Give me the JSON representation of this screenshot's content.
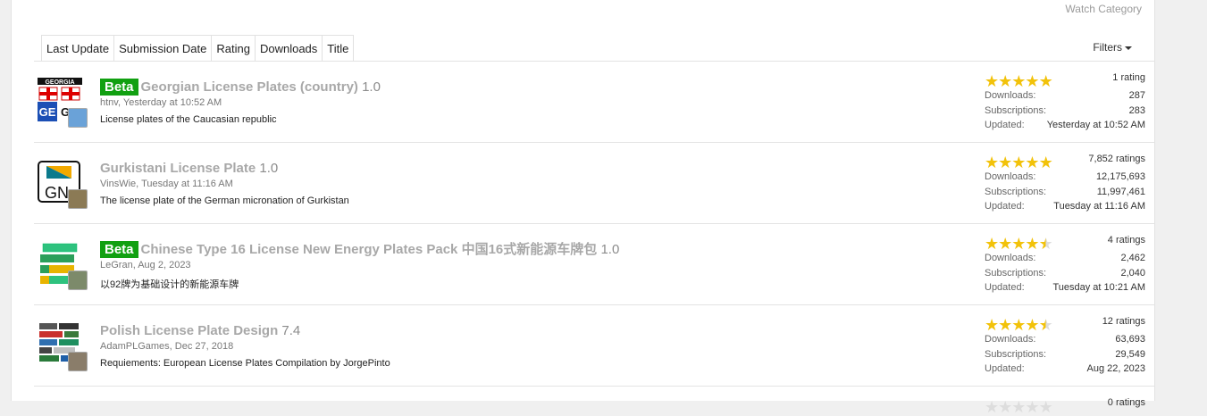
{
  "header": {
    "watch_category": "Watch Category",
    "filters_label": "Filters"
  },
  "tabs": [
    {
      "label": "Last Update"
    },
    {
      "label": "Submission Date"
    },
    {
      "label": "Rating"
    },
    {
      "label": "Downloads"
    },
    {
      "label": "Title"
    }
  ],
  "colors": {
    "beta_badge": "#11a011",
    "star_full": "#f2c20a",
    "star_empty": "#dddddd",
    "title_gray": "#a8a8a8"
  },
  "stats_labels": {
    "downloads": "Downloads:",
    "subscriptions": "Subscriptions:",
    "updated": "Updated:"
  },
  "items": [
    {
      "beta": "Beta",
      "name": "Georgian License Plates (country)",
      "version": "1.0",
      "author": "htnv",
      "date": "Yesterday at 10:52 AM",
      "description": "License plates of the Caucasian republic",
      "rating_text": "1 rating",
      "stars": 5,
      "downloads": "287",
      "subscriptions": "283",
      "updated": "Yesterday at 10:52 AM",
      "thumb_icon": "georgia-plate-icon"
    },
    {
      "beta": "",
      "name": "Gurkistani License Plate",
      "version": "1.0",
      "author": "VinsWie",
      "date": "Tuesday at 11:16 AM",
      "description": "The license plate of the German micronation of Gurkistan",
      "rating_text": "7,852 ratings",
      "stars": 5,
      "downloads": "12,175,693",
      "subscriptions": "11,997,461",
      "updated": "Tuesday at 11:16 AM",
      "thumb_icon": "gn-plate-icon"
    },
    {
      "beta": "Beta",
      "name": "Chinese Type 16 License New Energy Plates Pack 中国16式新能源车牌包",
      "version": "1.0",
      "author": "LeGran",
      "date": "Aug 2, 2023",
      "description": "以92牌为基础设计的新能源车牌",
      "rating_text": "4 ratings",
      "stars": 4.5,
      "downloads": "2,462",
      "subscriptions": "2,040",
      "updated": "Tuesday at 10:21 AM",
      "thumb_icon": "chinese-plates-icon"
    },
    {
      "beta": "",
      "name": "Polish License Plate Design",
      "version": "7.4",
      "author": "AdamPLGames",
      "date": "Dec 27, 2018",
      "description": "Requiements: European License Plates Compilation by JorgePinto",
      "rating_text": "12 ratings",
      "stars": 4.5,
      "downloads": "63,693",
      "subscriptions": "29,549",
      "updated": "Aug 22, 2023",
      "thumb_icon": "polish-plates-icon"
    }
  ],
  "partial": {
    "rating_text": "0 ratings"
  }
}
